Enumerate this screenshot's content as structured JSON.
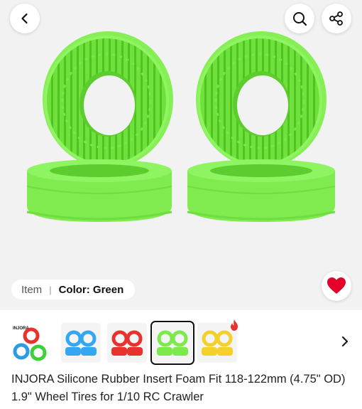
{
  "nav": {
    "back_icon": "chevron-left-icon",
    "search_icon": "search-icon",
    "share_icon": "share-icon"
  },
  "hero": {
    "image": "green-silicone-tire-inserts",
    "product_color": "#7bea4a"
  },
  "sku": {
    "item_label": "Item",
    "separator": "|",
    "color_label": "Color: Green"
  },
  "favorite": {
    "icon": "heart-icon",
    "color": "#e4002b",
    "active": true
  },
  "thumbnails": [
    {
      "name": "brand-multicolor",
      "logo": "INJORA",
      "colors": [
        "#e8322e",
        "#2a9be8",
        "#3fcf3a"
      ]
    },
    {
      "name": "blue",
      "colors": [
        "#35a7f0"
      ]
    },
    {
      "name": "red",
      "colors": [
        "#e8322e"
      ]
    },
    {
      "name": "green",
      "colors": [
        "#7bea4a"
      ],
      "selected": true
    },
    {
      "name": "yellow",
      "colors": [
        "#f5d02a"
      ],
      "hot": true
    }
  ],
  "thumb_more_icon": "chevron-right-icon",
  "product": {
    "title": "INJORA Silicone Rubber Insert Foam Fit 118-122mm (4.75\" OD) 1.9\" Wheel Tires for 1/10 RC Crawler"
  }
}
